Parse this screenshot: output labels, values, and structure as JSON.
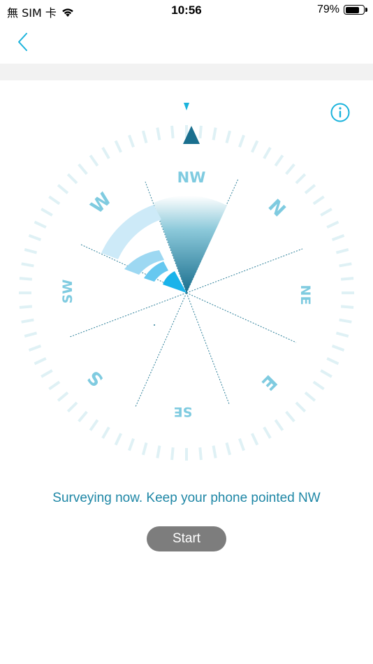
{
  "status_bar": {
    "carrier": "無 SIM 卡",
    "time": "10:56",
    "battery_percent": "79%",
    "battery_level": 0.79
  },
  "nav": {
    "back_icon": "chevron-left-icon"
  },
  "compass": {
    "target_direction": "NW",
    "labels": {
      "n": "N",
      "ne": "NE",
      "e": "E",
      "se": "SE",
      "s": "S",
      "sw": "SW",
      "w": "W",
      "nw": "NW"
    }
  },
  "instruction": "Surveying now. Keep your phone pointed NW",
  "start_label": "Start",
  "colors": {
    "accent": "#1ab3dc",
    "text_accent": "#1f87a6",
    "label": "#7fcbe0",
    "tick": "#dff1f5",
    "needle": "#1a6f8e",
    "button": "#7d7d7d"
  }
}
